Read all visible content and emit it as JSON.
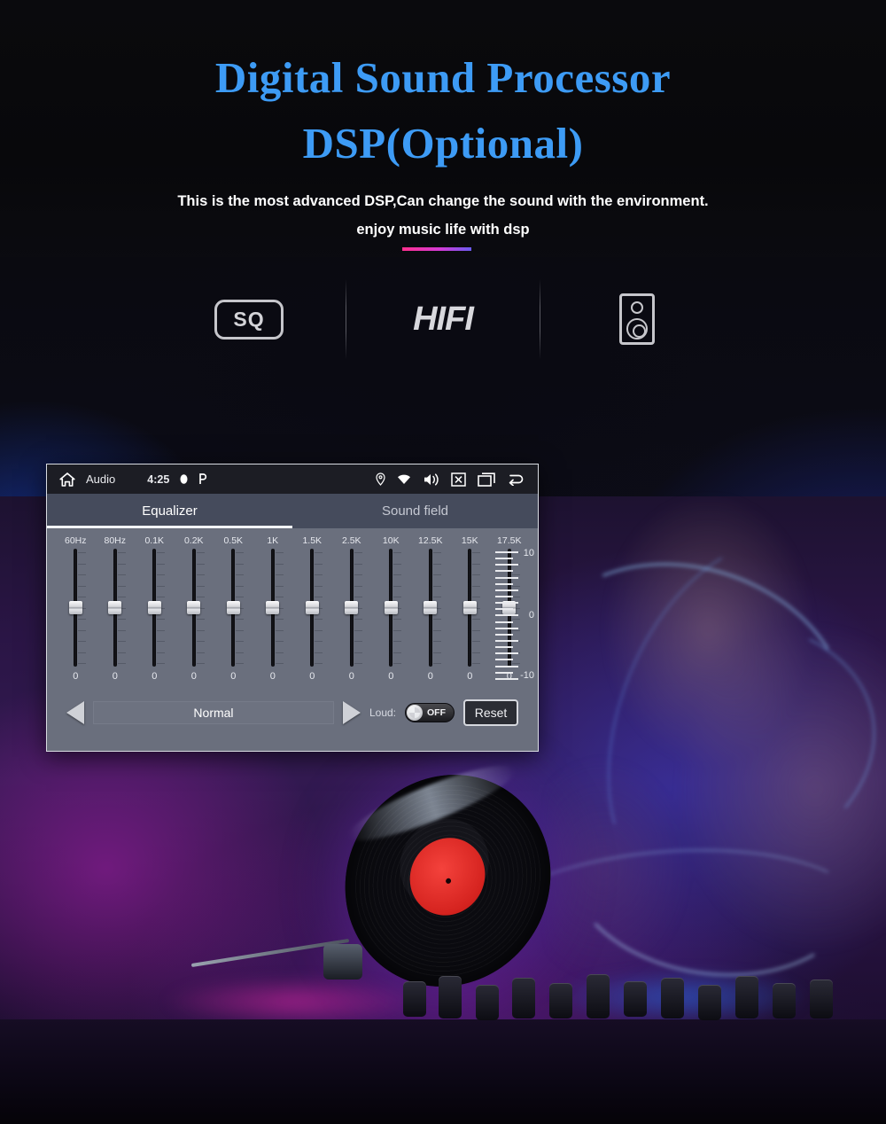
{
  "header": {
    "title_line1": "Digital  Sound Processor",
    "title_line2": "DSP(Optional)",
    "subtitle_line1": "This is the most advanced DSP,Can change the sound with the environment.",
    "subtitle_line2": "enjoy music life with dsp",
    "title_color": "#3d9bf5",
    "accent_gradient": [
      "#ff2f8e",
      "#6a5bf0"
    ]
  },
  "badges": [
    {
      "type": "sq",
      "label": "SQ",
      "icon": "sq-badge-icon"
    },
    {
      "type": "hifi",
      "label": "HIFI",
      "icon": "hifi-text-icon"
    },
    {
      "type": "speaker",
      "label": "",
      "icon": "speaker-icon"
    }
  ],
  "app": {
    "statusbar": {
      "home_icon": "home-icon",
      "app_name": "Audio",
      "time": "4:25",
      "left_glyphs": [
        "bluetooth-glyph",
        "p-glyph"
      ],
      "right_icons": [
        "location-icon",
        "wifi-icon",
        "volume-icon",
        "close-box-icon",
        "recents-icon",
        "back-icon"
      ]
    },
    "tabs": [
      {
        "label": "Equalizer",
        "active": true
      },
      {
        "label": "Sound field",
        "active": false
      }
    ],
    "equalizer": {
      "bands": [
        {
          "label": "60Hz",
          "value": "0"
        },
        {
          "label": "80Hz",
          "value": "0"
        },
        {
          "label": "0.1K",
          "value": "0"
        },
        {
          "label": "0.2K",
          "value": "0"
        },
        {
          "label": "0.5K",
          "value": "0"
        },
        {
          "label": "1K",
          "value": "0"
        },
        {
          "label": "1.5K",
          "value": "0"
        },
        {
          "label": "2.5K",
          "value": "0"
        },
        {
          "label": "10K",
          "value": "0"
        },
        {
          "label": "12.5K",
          "value": "0"
        },
        {
          "label": "15K",
          "value": "0"
        },
        {
          "label": "17.5K",
          "value": "0"
        }
      ],
      "scale": {
        "top": "10",
        "mid": "0",
        "bottom": "-10"
      }
    },
    "controls": {
      "prev_icon": "prev-arrow-icon",
      "preset": "Normal",
      "next_icon": "next-arrow-icon",
      "loud_label": "Loud:",
      "loud_state": "OFF",
      "reset_label": "Reset"
    }
  }
}
